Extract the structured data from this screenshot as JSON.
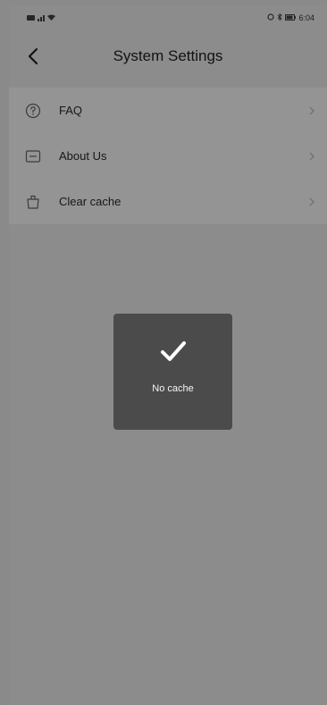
{
  "status_bar": {
    "left_text": "",
    "time": "6:04"
  },
  "header": {
    "back_icon": "chevron-left-icon",
    "title": "System Settings"
  },
  "menu": {
    "items": [
      {
        "icon": "question-circle-icon",
        "label": "FAQ"
      },
      {
        "icon": "message-square-icon",
        "label": "About Us"
      },
      {
        "icon": "trash-icon",
        "label": "Clear cache"
      }
    ]
  },
  "toast": {
    "icon": "checkmark-icon",
    "message": "No cache"
  },
  "colors": {
    "overlay": "#000000",
    "toast_bg": "#4b4b4b",
    "screen_bg": "#f2f2f2"
  }
}
